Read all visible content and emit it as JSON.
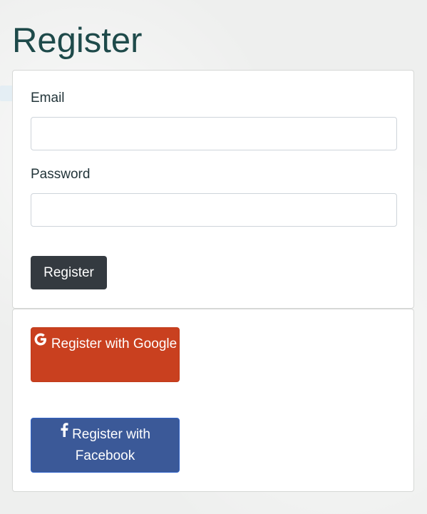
{
  "page": {
    "title": "Register"
  },
  "form": {
    "email_label": "Email",
    "email_value": "",
    "password_label": "Password",
    "password_value": "",
    "submit_label": "Register"
  },
  "social": {
    "google_label": "Register with Google",
    "google_icon": "google-icon",
    "google_color": "#c9401f",
    "facebook_label": "Register with Facebook",
    "facebook_icon": "facebook-icon",
    "facebook_color": "#3b5998"
  },
  "colors": {
    "title": "#1e4a4a",
    "submit_button": "#343a40"
  }
}
